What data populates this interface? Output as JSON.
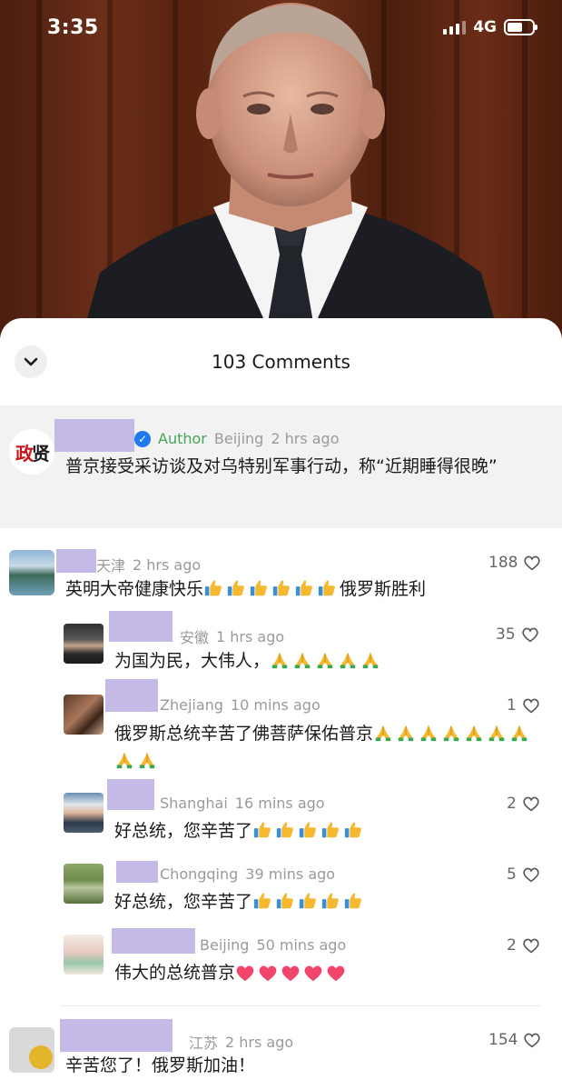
{
  "status_bar": {
    "time": "3:35",
    "network": "4G"
  },
  "sheet": {
    "comments_title": "103 Comments"
  },
  "author_post": {
    "avatar_text": "政贤",
    "author_label": "Author",
    "location": "Beijing",
    "time": "2 hrs ago",
    "text": "普京接受采访谈及对乌特别军事行动，称“近期睡得很晚”"
  },
  "comments": [
    {
      "partial_name": "天津",
      "location": "",
      "time": "2 hrs ago",
      "likes": "188",
      "text": "英明大帝健康快乐",
      "suffix": "俄罗斯胜利",
      "thumbs": 6
    },
    {
      "partial_name": "",
      "location": "安徽",
      "time": "1 hrs ago",
      "likes": "35",
      "text": "为国为民，大伟人，",
      "prays": 5
    },
    {
      "partial_name": "",
      "location": "Zhejiang",
      "time": "10 mins ago",
      "likes": "1",
      "text": "俄罗斯总统辛苦了佛菩萨保佑普京",
      "prays": 9
    },
    {
      "partial_name": "",
      "location": "Shanghai",
      "time": "16 mins ago",
      "likes": "2",
      "text": "好总统，您辛苦了",
      "thumbs": 5
    },
    {
      "partial_name": "",
      "location": "Chongqing",
      "time": "39 mins ago",
      "likes": "5",
      "text": "好总统，您辛苦了",
      "thumbs": 5
    },
    {
      "partial_name": "",
      "location": "Beijing",
      "time": "50 mins ago",
      "likes": "2",
      "text": "伟大的总统普京",
      "hearts": 5
    },
    {
      "partial_name": "",
      "location": "江苏",
      "time": "2 hrs ago",
      "likes": "154",
      "text": "辛苦您了！俄罗斯加油！"
    }
  ],
  "icons": {
    "collapse": "chevron-down-icon",
    "verified": "verified-badge-icon",
    "like": "heart-outline-icon",
    "thumbs": "thumbs-up-emoji",
    "pray": "folded-hands-emoji",
    "red_heart": "red-heart-emoji"
  },
  "colors": {
    "redaction": "#c5bae6",
    "author_green": "#4aa35b",
    "verified_blue": "#1f7af0",
    "author_bg": "#f2f2f2"
  }
}
